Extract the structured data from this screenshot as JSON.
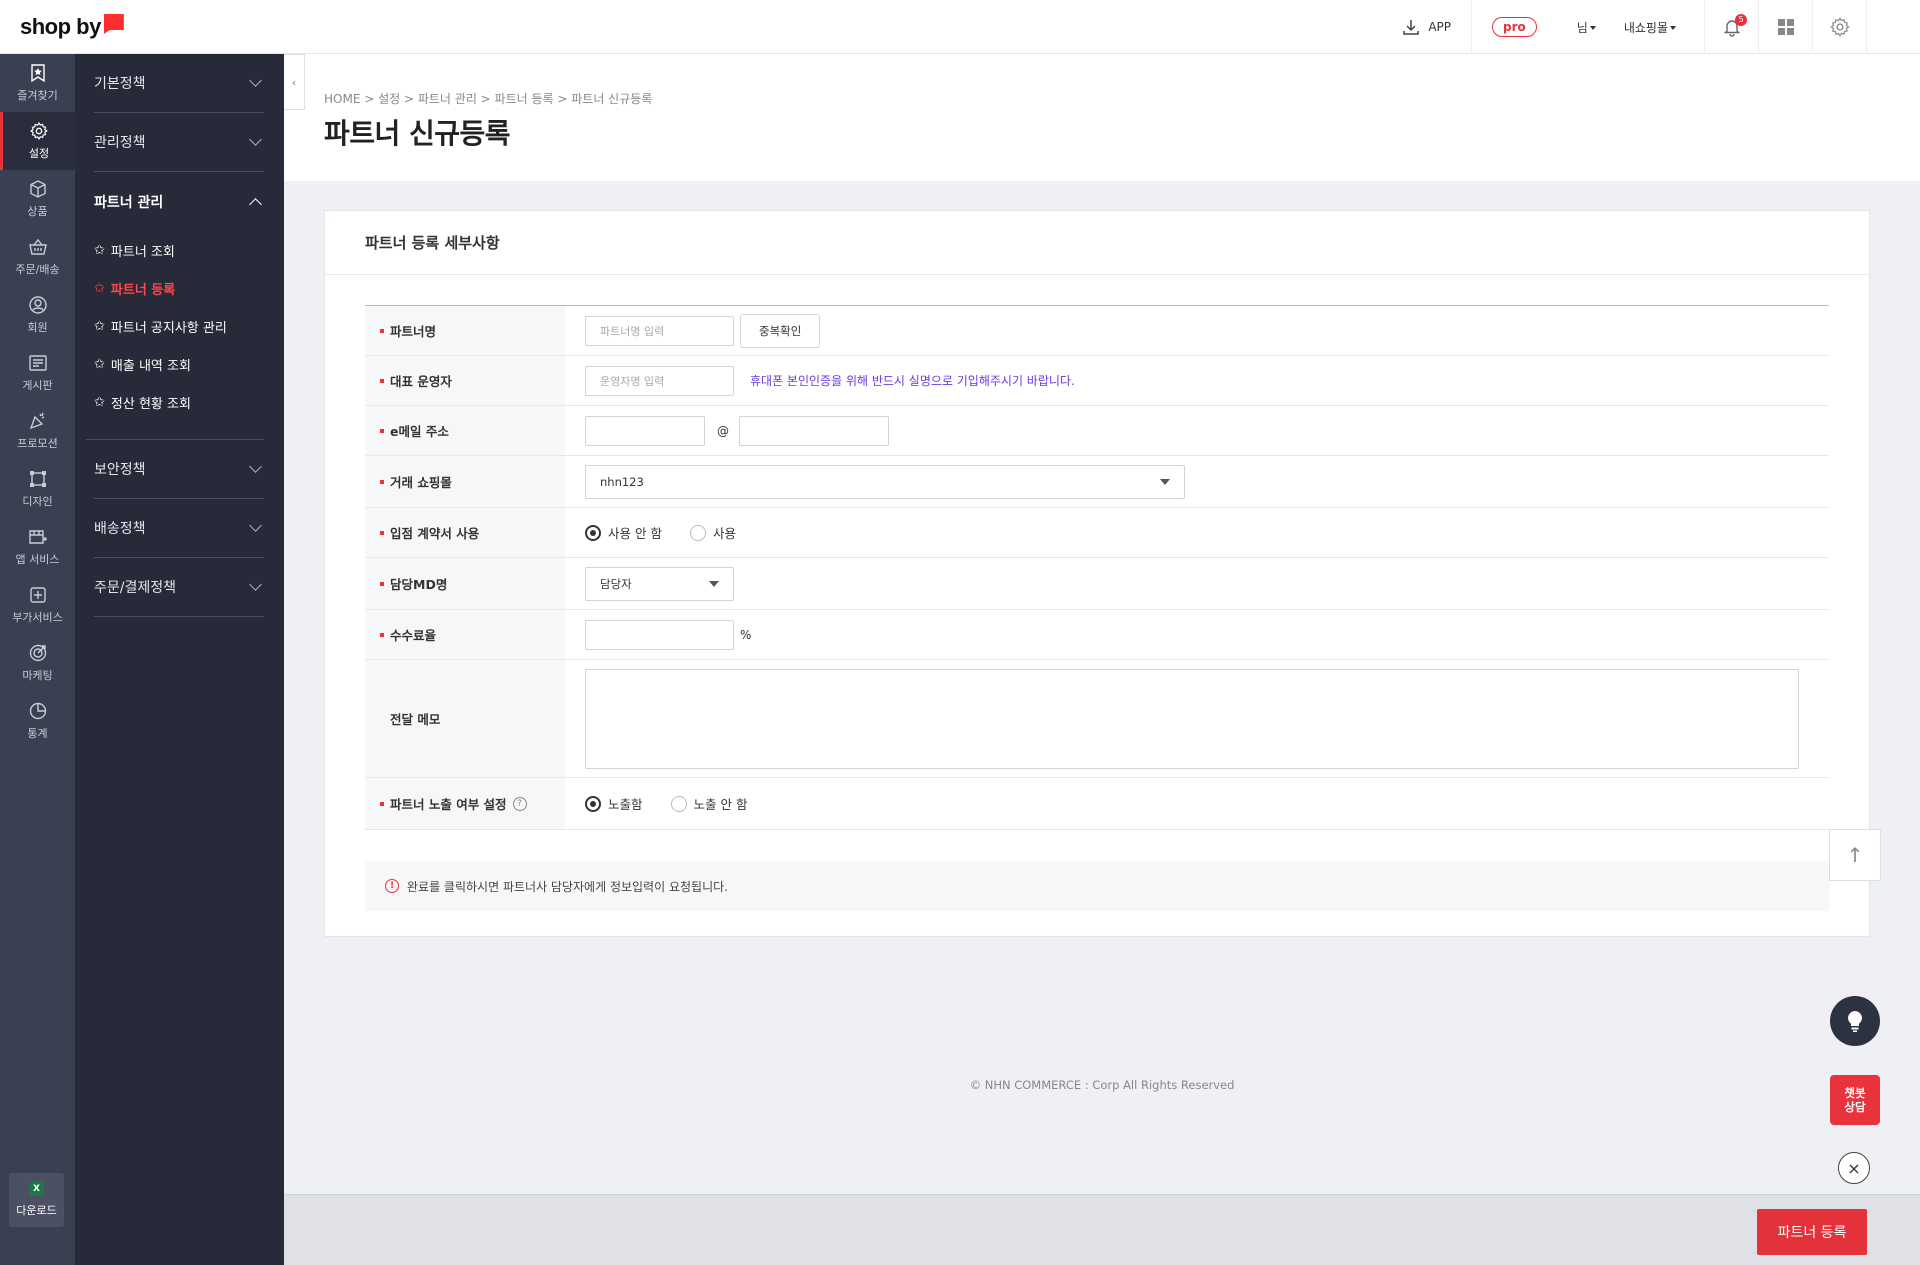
{
  "brand": {
    "logo_text": "shop by",
    "accent": "#e8323c"
  },
  "topbar": {
    "app_label": "APP",
    "pro_label": "pro",
    "user_label": "님",
    "mall_label": "내쇼핑몰",
    "notification_count": "5"
  },
  "rail": {
    "items": [
      {
        "label": "즐겨찾기",
        "icon": "star-bookmark-icon"
      },
      {
        "label": "설정",
        "icon": "gear-icon",
        "active": true
      },
      {
        "label": "상품",
        "icon": "box-icon"
      },
      {
        "label": "주문/배송",
        "icon": "basket-icon"
      },
      {
        "label": "회원",
        "icon": "user-icon"
      },
      {
        "label": "게시판",
        "icon": "board-icon"
      },
      {
        "label": "프로모션",
        "icon": "party-icon"
      },
      {
        "label": "디자인",
        "icon": "design-icon"
      },
      {
        "label": "앱 서비스",
        "icon": "app-service-icon"
      },
      {
        "label": "부가서비스",
        "icon": "addon-icon"
      },
      {
        "label": "마케팅",
        "icon": "target-icon"
      },
      {
        "label": "통계",
        "icon": "pie-chart-icon"
      }
    ],
    "download_label": "다운로드",
    "excel_label": "X"
  },
  "submenu": {
    "groups_top": [
      "기본정책",
      "관리정책"
    ],
    "open_group": "파트너 관리",
    "open_items": [
      {
        "label": "파트너 조회"
      },
      {
        "label": "파트너 등록",
        "active": true
      },
      {
        "label": "파트너 공지사항 관리"
      },
      {
        "label": "매출 내역 조회"
      },
      {
        "label": "정산 현황 조회"
      }
    ],
    "groups_bottom": [
      "보안정책",
      "배송정책",
      "주문/결제정책"
    ],
    "star_glyph": "✩"
  },
  "header": {
    "breadcrumb": "HOME > 설정 > 파트너 관리 > 파트너 등록 > 파트너 신규등록",
    "title": "파트너 신규등록"
  },
  "card": {
    "title": "파트너 등록 세부사항",
    "fields": {
      "partner_name": {
        "label": "파트너명",
        "placeholder": "파트너명 입력",
        "button": "중복확인"
      },
      "representative": {
        "label": "대표 운영자",
        "placeholder": "운영자명 입력",
        "notice": "휴대폰 본인인증을 위해 반드시 실명으로 기입해주시기 바랍니다."
      },
      "email": {
        "label": "e메일 주소",
        "at": "@"
      },
      "mall": {
        "label": "거래 쇼핑몰",
        "value": "nhn123"
      },
      "contract": {
        "label": "입점 계약서 사용",
        "options": [
          "사용 안 함",
          "사용"
        ],
        "selected": "사용 안 함"
      },
      "md": {
        "label": "담당MD명",
        "value": "담당자"
      },
      "commission": {
        "label": "수수료율",
        "unit": "%"
      },
      "memo": {
        "label": "전달 메모"
      },
      "exposure": {
        "label": "파트너 노출 여부 설정",
        "options": [
          "노출함",
          "노출 안 함"
        ],
        "selected": "노출함",
        "help": "?"
      }
    },
    "info_text": "완료를 클릭하시면 파트너사 담당자에게 정보입력이 요청됩니다.",
    "info_icon": "!"
  },
  "footer": {
    "copyright": "© NHN COMMERCE : Corp All Rights Reserved"
  },
  "bottom_bar": {
    "submit_label": "파트너 등록"
  },
  "floating": {
    "top_arrow": "↑",
    "chat_label": "챗봇\n상담",
    "close": "×"
  }
}
